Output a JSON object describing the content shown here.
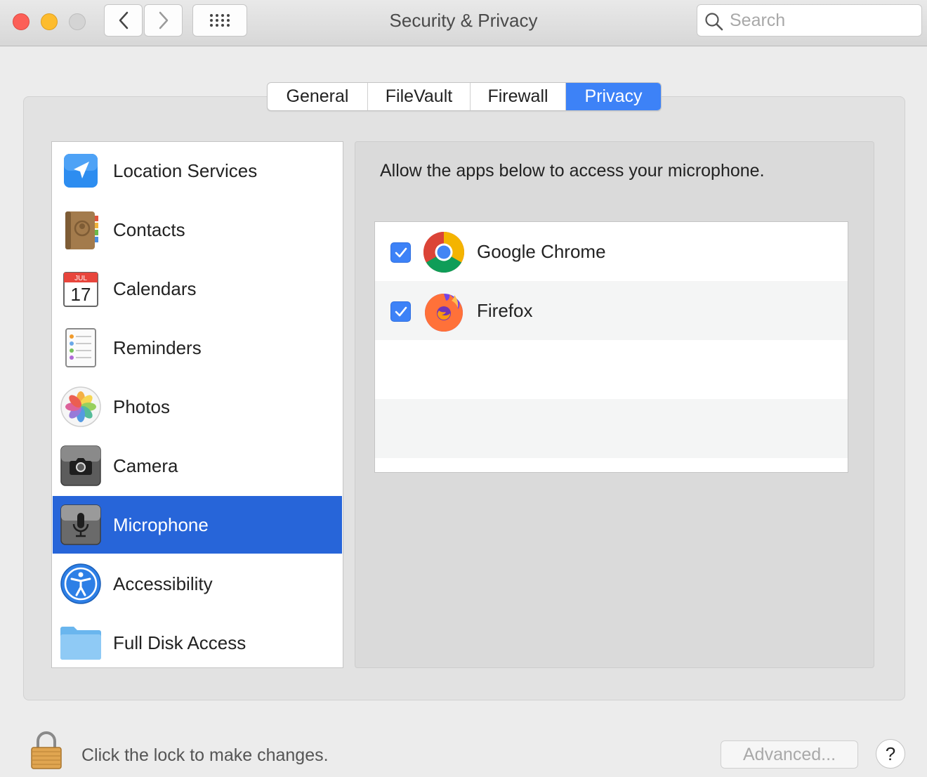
{
  "window": {
    "title": "Security & Privacy",
    "search_placeholder": "Search"
  },
  "toolbar": {
    "back_icon": "chevron-left-icon",
    "forward_icon": "chevron-right-icon",
    "show_all_icon": "grid-icon"
  },
  "tabs": [
    {
      "label": "General",
      "active": false
    },
    {
      "label": "FileVault",
      "active": false
    },
    {
      "label": "Firewall",
      "active": false
    },
    {
      "label": "Privacy",
      "active": true
    }
  ],
  "categories": [
    {
      "label": "Location Services",
      "icon": "location-arrow-icon",
      "selected": false
    },
    {
      "label": "Contacts",
      "icon": "contacts-book-icon",
      "selected": false
    },
    {
      "label": "Calendars",
      "icon": "calendar-icon",
      "month": "JUL",
      "day": "17",
      "selected": false
    },
    {
      "label": "Reminders",
      "icon": "reminders-list-icon",
      "selected": false
    },
    {
      "label": "Photos",
      "icon": "photos-pinwheel-icon",
      "selected": false
    },
    {
      "label": "Camera",
      "icon": "camera-icon",
      "selected": false
    },
    {
      "label": "Microphone",
      "icon": "microphone-icon",
      "selected": true
    },
    {
      "label": "Accessibility",
      "icon": "accessibility-icon",
      "selected": false
    },
    {
      "label": "Full Disk Access",
      "icon": "folder-icon",
      "selected": false
    }
  ],
  "panel": {
    "description": "Allow the apps below to access your microphone.",
    "apps": [
      {
        "name": "Google Chrome",
        "checked": true,
        "icon": "chrome-icon"
      },
      {
        "name": "Firefox",
        "checked": true,
        "icon": "firefox-icon"
      }
    ]
  },
  "footer": {
    "lock_message": "Click the lock to make changes.",
    "advanced_label": "Advanced...",
    "help_label": "?"
  },
  "colors": {
    "accent": "#3d82f7",
    "selection": "#2765d9",
    "window_bg": "#ececec"
  }
}
